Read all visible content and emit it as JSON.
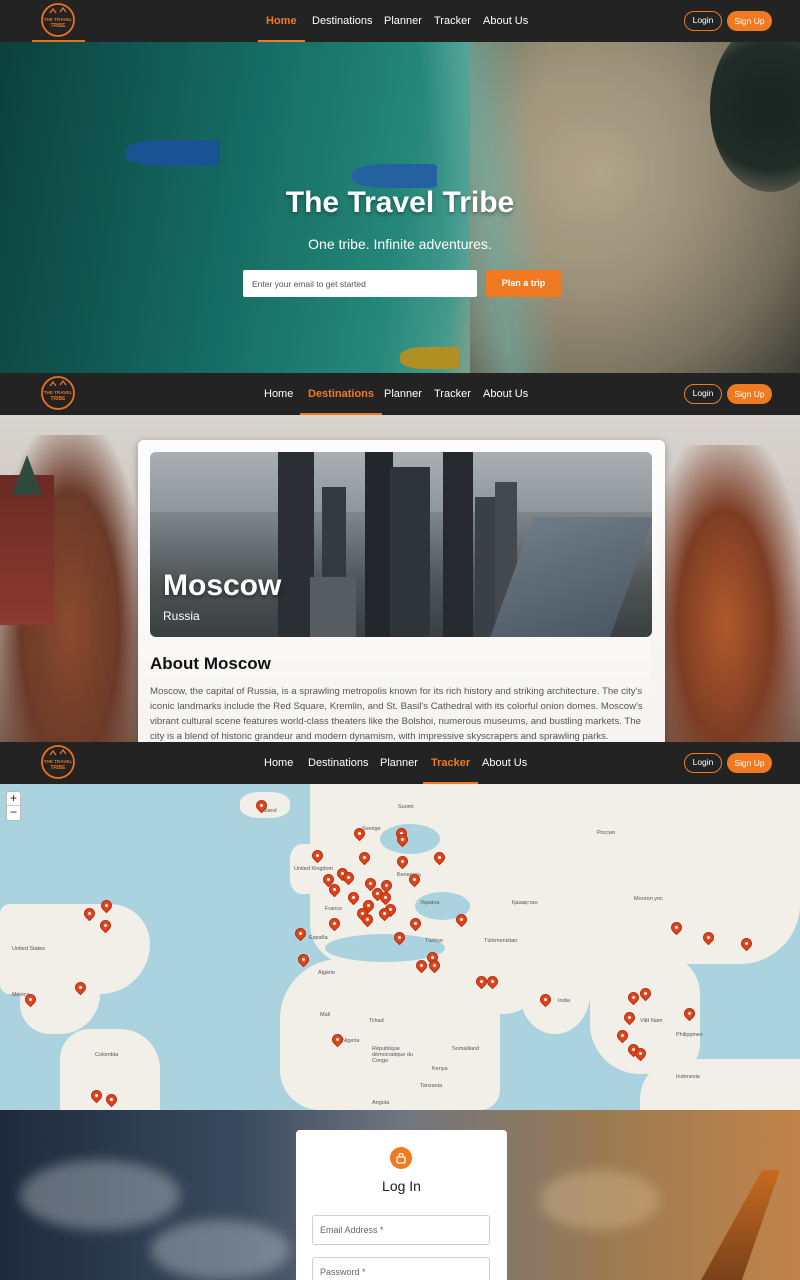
{
  "brand": {
    "logo_text": "THE TRAVEL TRIBE",
    "accent": "#f07a22"
  },
  "nav": {
    "items": [
      "Home",
      "Destinations",
      "Planner",
      "Tracker",
      "About Us"
    ],
    "login": "Login",
    "signup": "Sign Up"
  },
  "hero": {
    "title": "The Travel Tribe",
    "subtitle": "One tribe. Infinite adventures.",
    "email_placeholder": "Enter your email to get started",
    "cta": "Plan a trip"
  },
  "destination": {
    "city": "Moscow",
    "country": "Russia",
    "about_title": "About Moscow",
    "about_text": "Moscow, the capital of Russia, is a sprawling metropolis known for its rich history and striking architecture. The city's iconic landmarks include the Red Square, Kremlin, and St. Basil's Cathedral with its colorful onion domes. Moscow's vibrant cultural scene features world-class theaters like the Bolshoi, numerous museums, and bustling markets. The city is a blend of historic grandeur and modern dynamism, with impressive skyscrapers and sprawling parks."
  },
  "map": {
    "zoom_in": "+",
    "zoom_out": "−",
    "labels": [
      "Ísland",
      "Sverige",
      "Suomi",
      "Россия",
      "United Kingdom",
      "Беларусь",
      "France",
      "Україна",
      "Қазақстан",
      "Монгол улс",
      "España",
      "Türkiye",
      "Türkmenistan",
      "United States",
      "Algérie",
      "México",
      "India",
      "Việt Nam",
      "Mali",
      "Tchad",
      "Philippines",
      "Nigeria",
      "Colombia",
      "République démocratique du Congo",
      "Kenya",
      "Tanzania",
      "Angola",
      "Indonesia",
      "Somaliland"
    ]
  },
  "login": {
    "title": "Log In",
    "email_placeholder": "Email Address *",
    "password_placeholder": "Password *"
  }
}
